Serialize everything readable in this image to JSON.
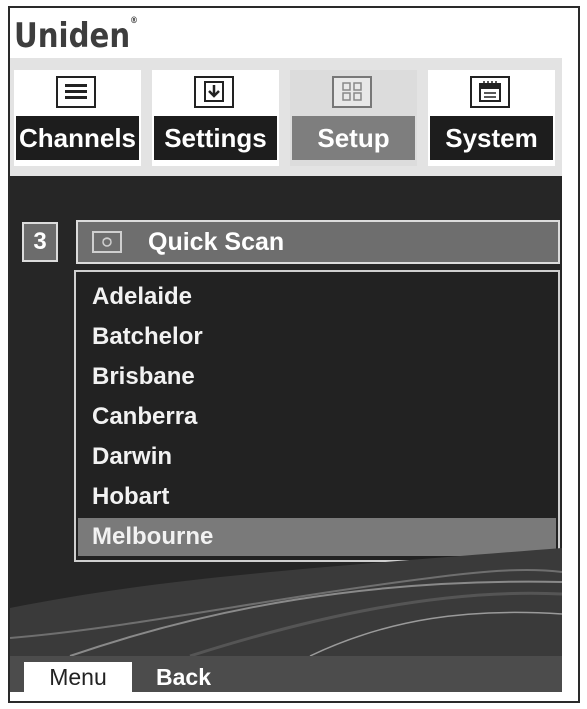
{
  "brand": {
    "name": "Uniden",
    "mark": "®"
  },
  "tabs": [
    {
      "label": "Channels",
      "icon": "list-icon",
      "active": false
    },
    {
      "label": "Settings",
      "icon": "download-icon",
      "active": false
    },
    {
      "label": "Setup",
      "icon": "grid-icon",
      "active": true
    },
    {
      "label": "System",
      "icon": "calendar-icon",
      "active": false
    }
  ],
  "screen": {
    "index": "3",
    "header_title": "Quick Scan",
    "header_icon": "scan-icon"
  },
  "list": {
    "items": [
      "Adelaide",
      "Batchelor",
      "Brisbane",
      "Canberra",
      "Darwin",
      "Hobart",
      "Melbourne"
    ],
    "selected": "Melbourne"
  },
  "softkeys": {
    "menu": "Menu",
    "back": "Back"
  }
}
